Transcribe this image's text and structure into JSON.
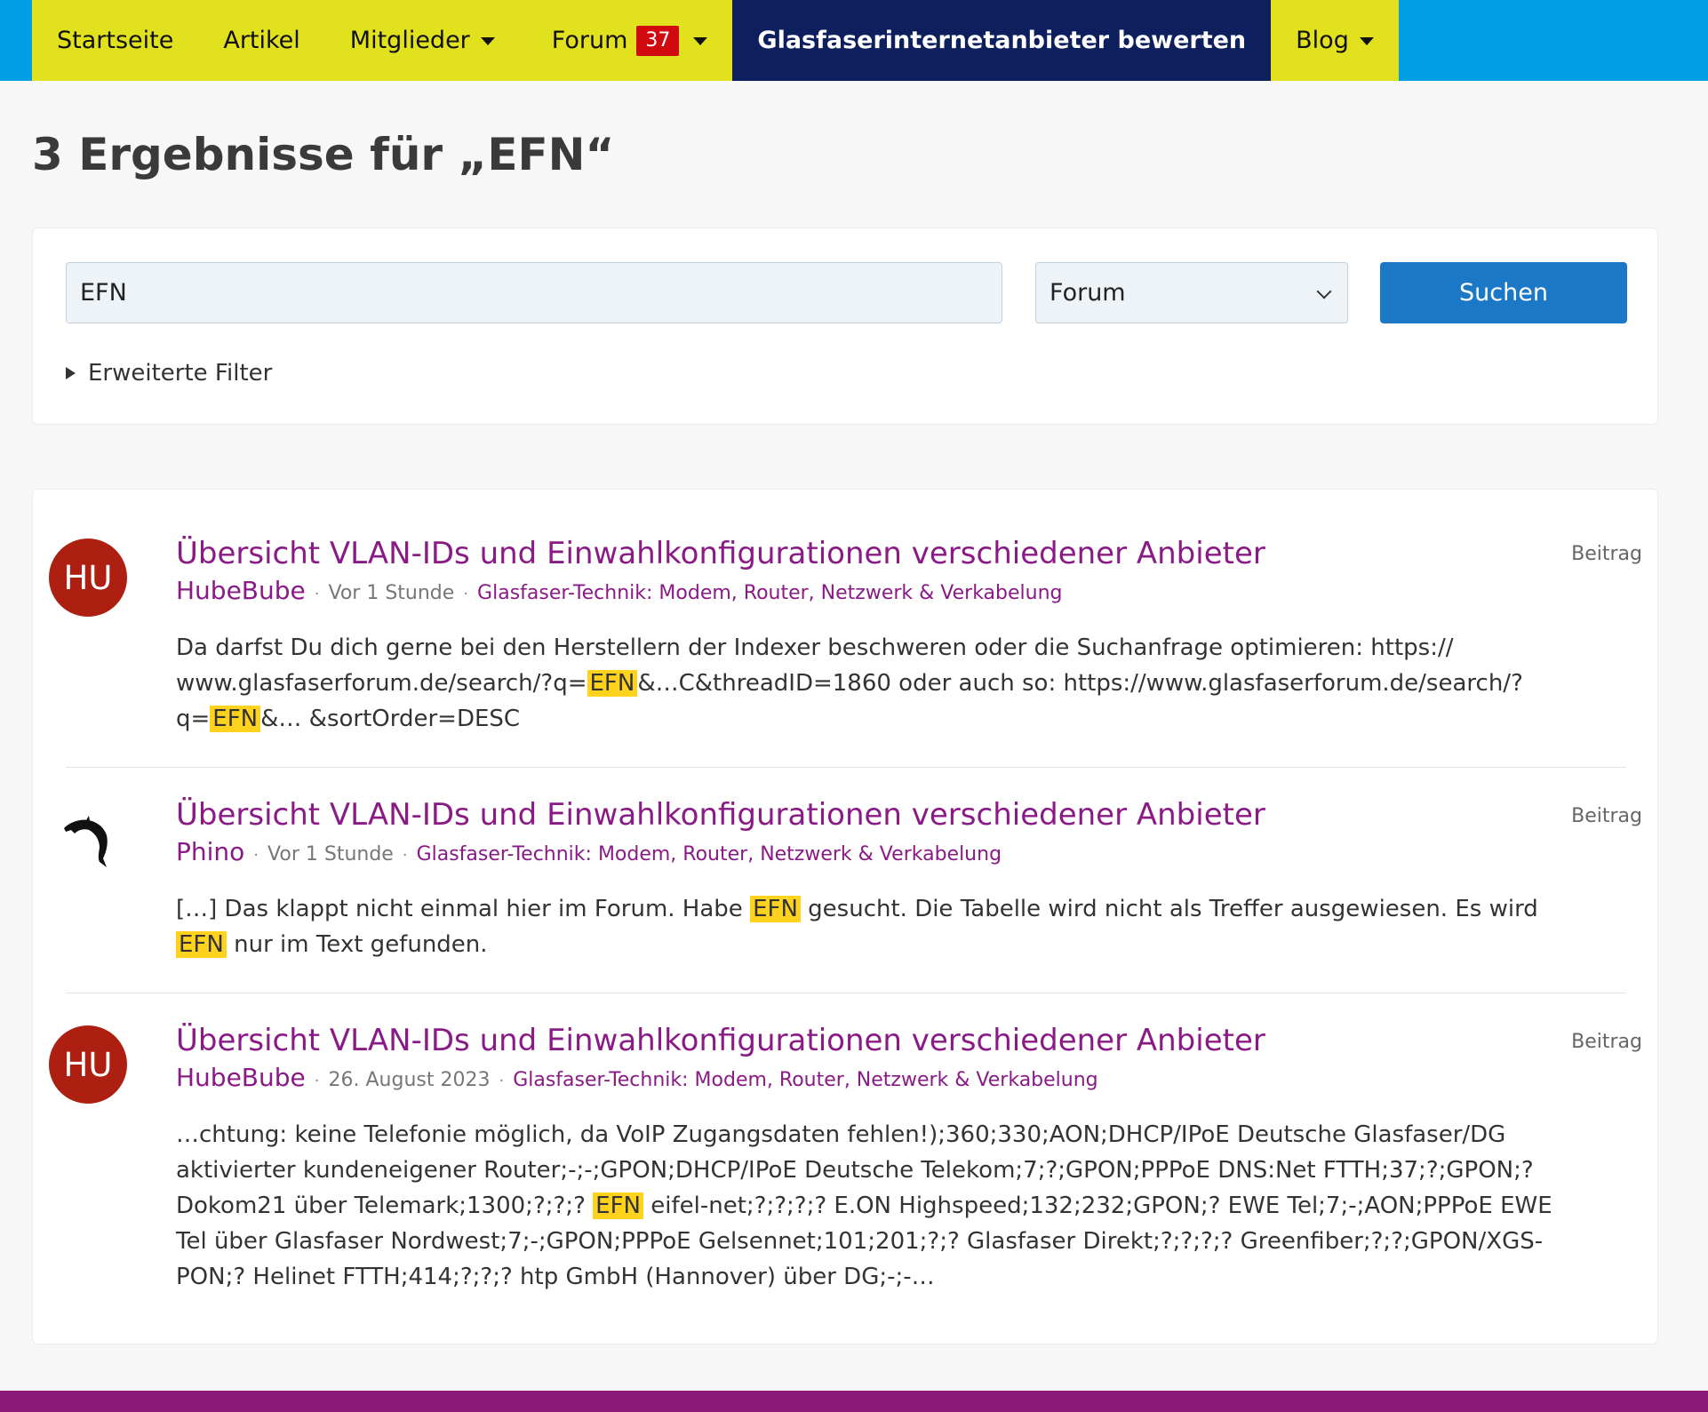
{
  "nav": {
    "items": [
      {
        "label": "Startseite"
      },
      {
        "label": "Artikel"
      },
      {
        "label": "Mitglieder"
      },
      {
        "label": "Forum",
        "badge": "37"
      },
      {
        "label": "Glasfaserinternetanbieter bewerten"
      },
      {
        "label": "Blog"
      }
    ]
  },
  "page": {
    "title": "3 Ergebnisse für „EFN“"
  },
  "search": {
    "query": "EFN",
    "scope": "Forum",
    "button_label": "Suchen",
    "filters_label": "Erweiterte Filter"
  },
  "results": [
    {
      "avatar_initials": "HU",
      "title": "Übersicht VLAN-IDs und Einwahlkonfigurationen verschiedener Anbieter",
      "type": "Beitrag",
      "author": "HubeBube",
      "time": "Vor 1 Stunde",
      "board": "Glasfaser-Technik: Modem, Router, Netzwerk & Verkabelung",
      "snippet": [
        {
          "text": "Da darfst Du dich gerne bei den Herstellern der Indexer beschweren oder die Suchanfrage optimieren: https:// www.glasfaserforum.de/search/?q="
        },
        {
          "text": "EFN",
          "hl": true
        },
        {
          "text": "&…C&threadID=1860 oder auch so: https://www.glasfaserforum.de/search/?q="
        },
        {
          "text": "EFN",
          "hl": true
        },
        {
          "text": "&… &sortOrder=DESC"
        }
      ]
    },
    {
      "avatar_icon": "dolphin-icon",
      "title": "Übersicht VLAN-IDs und Einwahlkonfigurationen verschiedener Anbieter",
      "type": "Beitrag",
      "author": "Phino",
      "time": "Vor 1 Stunde",
      "board": "Glasfaser-Technik: Modem, Router, Netzwerk & Verkabelung",
      "snippet": [
        {
          "text": "[…] Das klappt nicht einmal hier im Forum. Habe "
        },
        {
          "text": "EFN",
          "hl": true
        },
        {
          "text": " gesucht. Die Tabelle wird nicht als Treffer ausgewiesen. Es wird "
        },
        {
          "text": "EFN",
          "hl": true
        },
        {
          "text": " nur im Text gefunden."
        }
      ]
    },
    {
      "avatar_initials": "HU",
      "title": "Übersicht VLAN-IDs und Einwahlkonfigurationen verschiedener Anbieter",
      "type": "Beitrag",
      "author": "HubeBube",
      "time": "26. August 2023",
      "board": "Glasfaser-Technik: Modem, Router, Netzwerk & Verkabelung",
      "snippet": [
        {
          "text": "…chtung: keine Telefonie möglich, da VoIP Zugangsdaten fehlen!);360;330;AON;DHCP/IPoE Deutsche Glasfaser/DG aktivierter kundeneigener Router;-;-;GPON;DHCP/IPoE Deutsche Telekom;7;?;GPON;PPPoE DNS:Net FTTH;37;?;GPON;? Dokom21 über Telemark;1300;?;?;? "
        },
        {
          "text": "EFN",
          "hl": true
        },
        {
          "text": " eifel-net;?;?;?;? E.ON Highspeed;132;232;GPON;? EWE Tel;7;-;AON;PPPoE EWE Tel über Glasfaser Nordwest;7;-;GPON;PPPoE Gelsennet;101;201;?;? Glasfaser Direkt;?;?;?;? Greenfiber;?;?;GPON/XGS-PON;? Helinet FTTH;414;?;?;? htp GmbH (Hannover) über DG;-;-…"
        }
      ]
    }
  ],
  "colors": {
    "topbar": "#009ee2",
    "nav_bg": "#e1e11e",
    "nav_active_bg": "#0d1f5c",
    "badge": "#d10a10",
    "link": "#8a1a85",
    "button": "#1b78c7",
    "highlight": "#ffd21e",
    "avatar": "#ad1f10",
    "footer": "#8a1a7a"
  }
}
